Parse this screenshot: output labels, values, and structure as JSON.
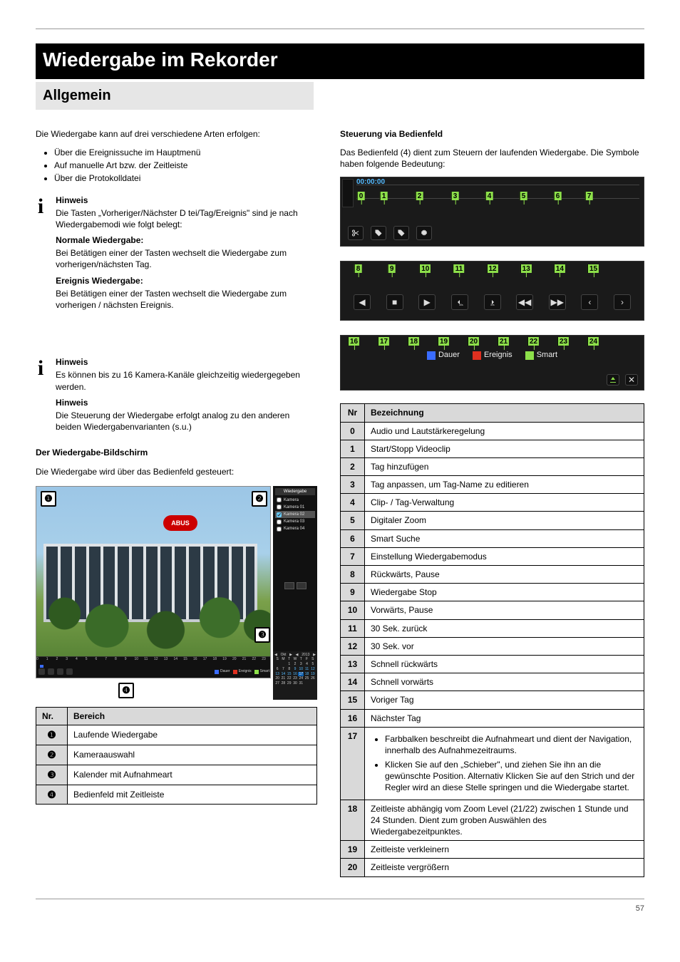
{
  "section_banner": "Wiedergabe im Rekorder",
  "sub_banner": "Allgemein",
  "intro": "Die Wiedergabe kann auf drei verschiedene Arten erfolgen:",
  "modes": [
    "Über die Ereignissuche im Hauptmenü",
    "Auf manuelle Art bzw. der Zeitleiste",
    "Über die Protokolldatei"
  ],
  "note1_head": "Hinweis",
  "note1_body": "Die Tasten „Vorheriger/Nächster D tei/Tag/Ereignis\" sind je nach Wiedergabemodi wie folgt belegt:",
  "note1_cont_head": "Normale Wiedergabe:",
  "note1_cont_1": "Bei Betätigen einer der Tasten wechselt die Wiedergabe zum vorherigen/nächsten Tag.",
  "note1_cont_ev_head": "Ereignis Wiedergabe:",
  "note1_cont_ev_1": "Bei Betätigen einer der Tasten wechselt die Wiedergabe zum vorherigen / nächsten Ereignis.",
  "note2_head1": "Hinweis",
  "note2_body1": "Es können bis zu 16 Kamera-Kanäle gleichzeitig wiedergegeben werden.",
  "note2_head2": "Hinweis",
  "note2_body2": "Die Steuerung der Wiedergabe erfolgt analog zu den anderen beiden Wiedergabenvarianten (s.u.)",
  "pb_screen_heading": "Der Wiedergabe-Bildschirm",
  "pb_screen_intro": "Die Wiedergabe wird über das Bedienfeld gesteuert:",
  "reg_table": {
    "headers": [
      "Nr.",
      "Bereich"
    ],
    "rows": [
      [
        "❶",
        "Laufende Wiedergabe"
      ],
      [
        "❷",
        "Kameraauswahl"
      ],
      [
        "❸",
        "Kalender mit Aufnahmeart"
      ],
      [
        "❹",
        "Bedienfeld mit Zeitleiste"
      ]
    ]
  },
  "side_panel": {
    "title": "Wiedergabe",
    "cams": [
      "Kamera",
      "Kamera 01",
      "Kamera 02",
      "Kamera 03",
      "Kamera 04"
    ],
    "cal_month": "Okt",
    "cal_year": "2013",
    "dow": [
      "S",
      "M",
      "T",
      "W",
      "T",
      "F",
      "S"
    ],
    "days": [
      "",
      "",
      "1",
      "2",
      "3",
      "4",
      "5",
      "6",
      "7",
      "8",
      "9",
      "10",
      "11",
      "12",
      "13",
      "14",
      "15",
      "16",
      "17",
      "18",
      "19",
      "20",
      "21",
      "22",
      "23",
      "24",
      "25",
      "26",
      "27",
      "28",
      "29",
      "30",
      "31",
      ""
    ]
  },
  "timeline": {
    "start": "00:00:00",
    "ticks1": [
      "0",
      "1",
      "2",
      "3",
      "4",
      "5",
      "6",
      "7"
    ],
    "calls1": [
      "0",
      "1",
      "2",
      "3",
      "4",
      "5",
      "6",
      "7"
    ],
    "calls2": [
      "8",
      "9",
      "10",
      "11",
      "12",
      "13",
      "14",
      "15"
    ],
    "calls3": [
      "16",
      "17",
      "18",
      "19",
      "20",
      "21",
      "22",
      "23",
      "24"
    ],
    "legend": {
      "d": "Dauer",
      "e": "Ereignis",
      "s": "Smart"
    },
    "main_ticks": [
      "0",
      "1",
      "2",
      "3",
      "4",
      "5",
      "6",
      "7",
      "8",
      "9",
      "10",
      "11",
      "12",
      "13",
      "14",
      "15",
      "16",
      "17",
      "18",
      "19",
      "20",
      "21",
      "22",
      "23"
    ]
  },
  "icons": {
    "scissors": "Clip",
    "tag": "Tag",
    "tagplus": "Tag+",
    "gear": "Gear",
    "rev": "◀",
    "stop": "■",
    "play": "▶",
    "fb": "◀◀",
    "ff": "▶▶",
    "prev": "‹",
    "next": "›",
    "hide": "▼",
    "close": "✕",
    "s30b": "30s◀",
    "s30f": "30s▶"
  },
  "ctrl_table": {
    "hdr_nr": "Nr",
    "hdr_desc": "Bezeichnung",
    "rows": [
      [
        "0",
        "Audio und Lautstärkeregelung"
      ],
      [
        "1",
        "Start/Stopp Videoclip"
      ],
      [
        "2",
        "Tag hinzufügen"
      ],
      [
        "3",
        "Tag anpassen, um Tag-Name zu editieren"
      ],
      [
        "4",
        "Clip- / Tag-Verwaltung"
      ],
      [
        "5",
        "Digitaler Zoom"
      ],
      [
        "6",
        "Smart Suche"
      ],
      [
        "7",
        "Einstellung Wiedergabemodus"
      ],
      [
        "8",
        "Rückwärts, Pause"
      ],
      [
        "9",
        "Wiedergabe Stop"
      ],
      [
        "10",
        "Vorwärts, Pause"
      ],
      [
        "11",
        "30 Sek. zurück"
      ],
      [
        "12",
        "30 Sek. vor"
      ],
      [
        "13",
        "Schnell rückwärts"
      ],
      [
        "14",
        "Schnell vorwärts"
      ],
      [
        "15",
        "Voriger Tag"
      ],
      [
        "16",
        "Nächster Tag"
      ]
    ],
    "row17_nr": "17",
    "row17_b1": "Farbbalken beschreibt die Aufnahmeart und dient der Navigation, innerhalb des Aufnahmezeitraums.",
    "row17_b2": "Klicken Sie auf den „Schieber\", und ziehen Sie ihn an die gewünschte Position. Alternativ Klicken Sie auf den Strich und der Regler wird an diese Stelle springen und die Wiedergabe startet.",
    "row18": [
      "18",
      "Zeitleiste abhängig vom Zoom Level (21/22) zwischen 1 Stunde und 24 Stunden. Dient zum groben Auswählen des Wiedergabezeitpunktes."
    ],
    "row19": [
      "19",
      "Zeitleiste verkleinern"
    ],
    "row20": [
      "20",
      "Zeitleiste vergrößern"
    ]
  },
  "logo": "ABUS",
  "page_no": "57"
}
